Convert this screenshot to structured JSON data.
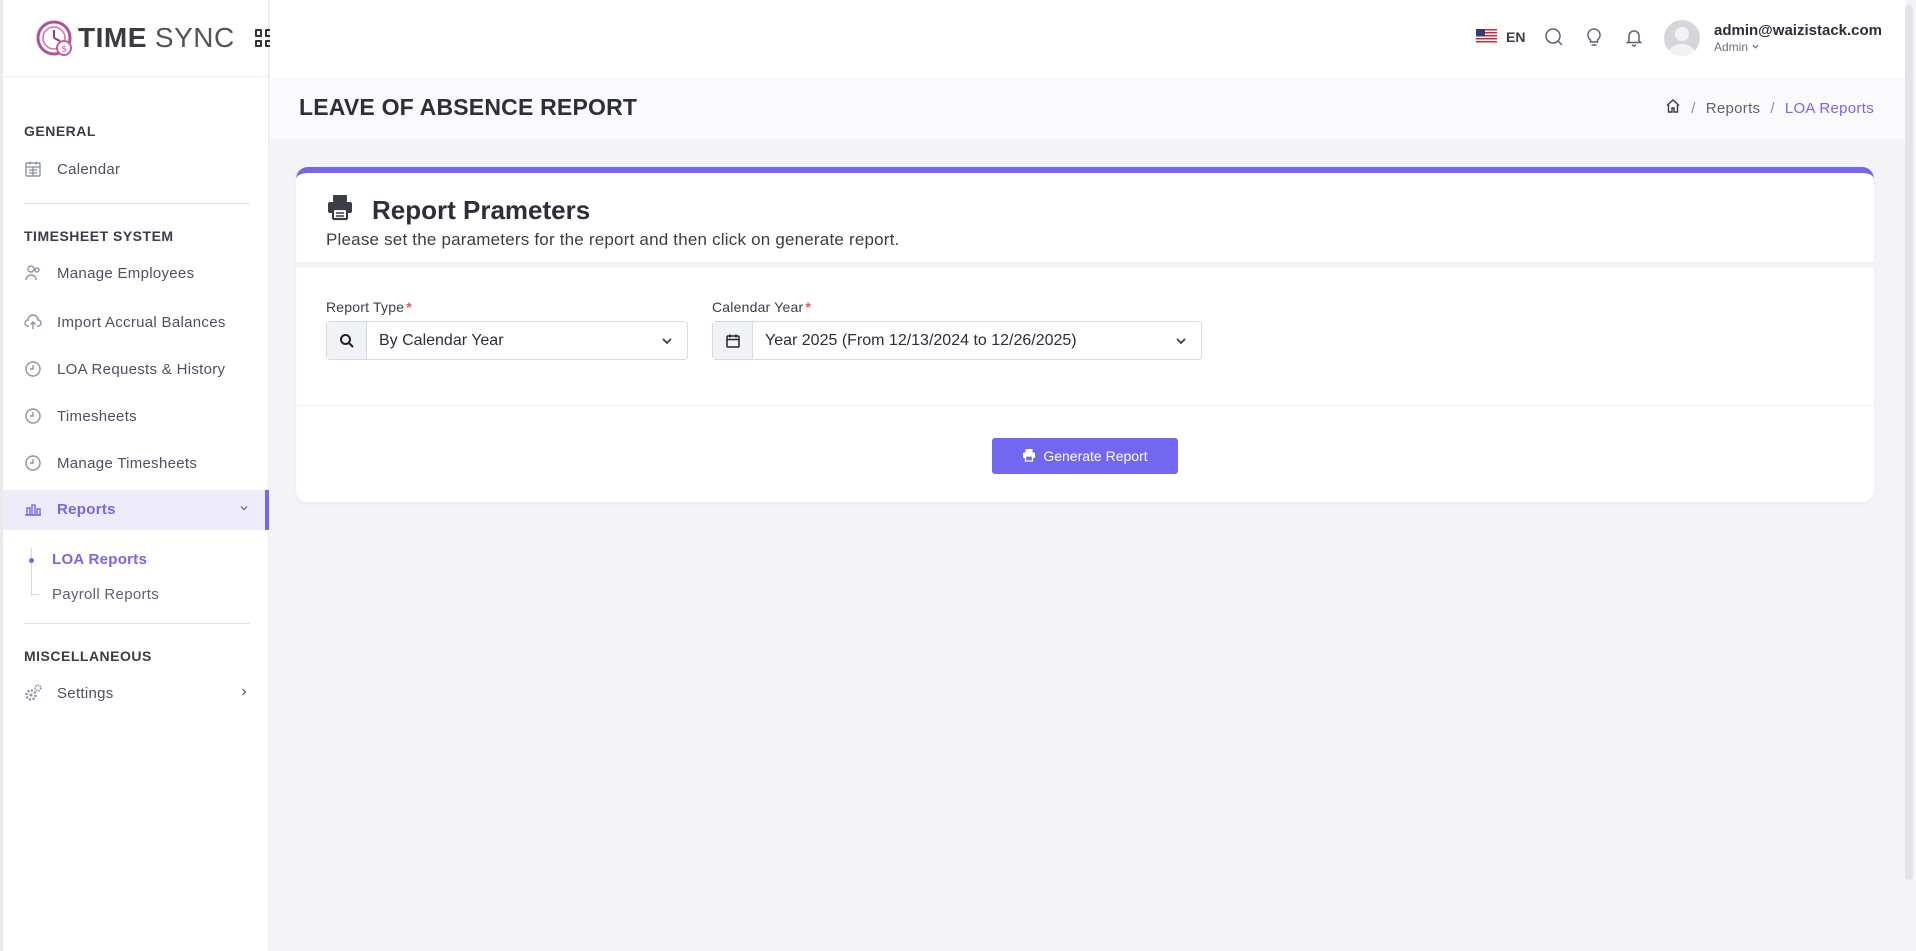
{
  "brand": {
    "name_bold": "TIME",
    "name_light": "SYNC"
  },
  "sidebar": {
    "sections": {
      "general": "GENERAL",
      "timesheet": "TIMESHEET SYSTEM",
      "misc": "MISCELLANEOUS"
    },
    "items": {
      "calendar": "Calendar",
      "manage_employees": "Manage Employees",
      "import_accrual": "Import Accrual Balances",
      "loa_requests": "LOA Requests & History",
      "timesheets": "Timesheets",
      "manage_timesheets": "Manage Timesheets",
      "reports": "Reports",
      "settings": "Settings"
    },
    "reports_sub": {
      "loa_reports": "LOA Reports",
      "payroll_reports": "Payroll Reports"
    }
  },
  "topbar": {
    "language": "EN",
    "user_email": "admin@waizistack.com",
    "user_role": "Admin"
  },
  "page": {
    "title": "LEAVE OF ABSENCE REPORT",
    "breadcrumb": {
      "reports": "Reports",
      "current": "LOA Reports",
      "sep": "/"
    }
  },
  "card": {
    "title": "Report Prameters",
    "subtitle": "Please set the parameters for the report and then click on generate report.",
    "report_type": {
      "label": "Report Type",
      "required": "*",
      "value": "By Calendar Year"
    },
    "calendar_year": {
      "label": "Calendar Year",
      "required": "*",
      "value": "Year 2025 (From 12/13/2024 to 12/26/2025)"
    },
    "generate_button": "Generate Report"
  },
  "colors": {
    "accent": "#7367f0",
    "required": "#ea5455"
  }
}
